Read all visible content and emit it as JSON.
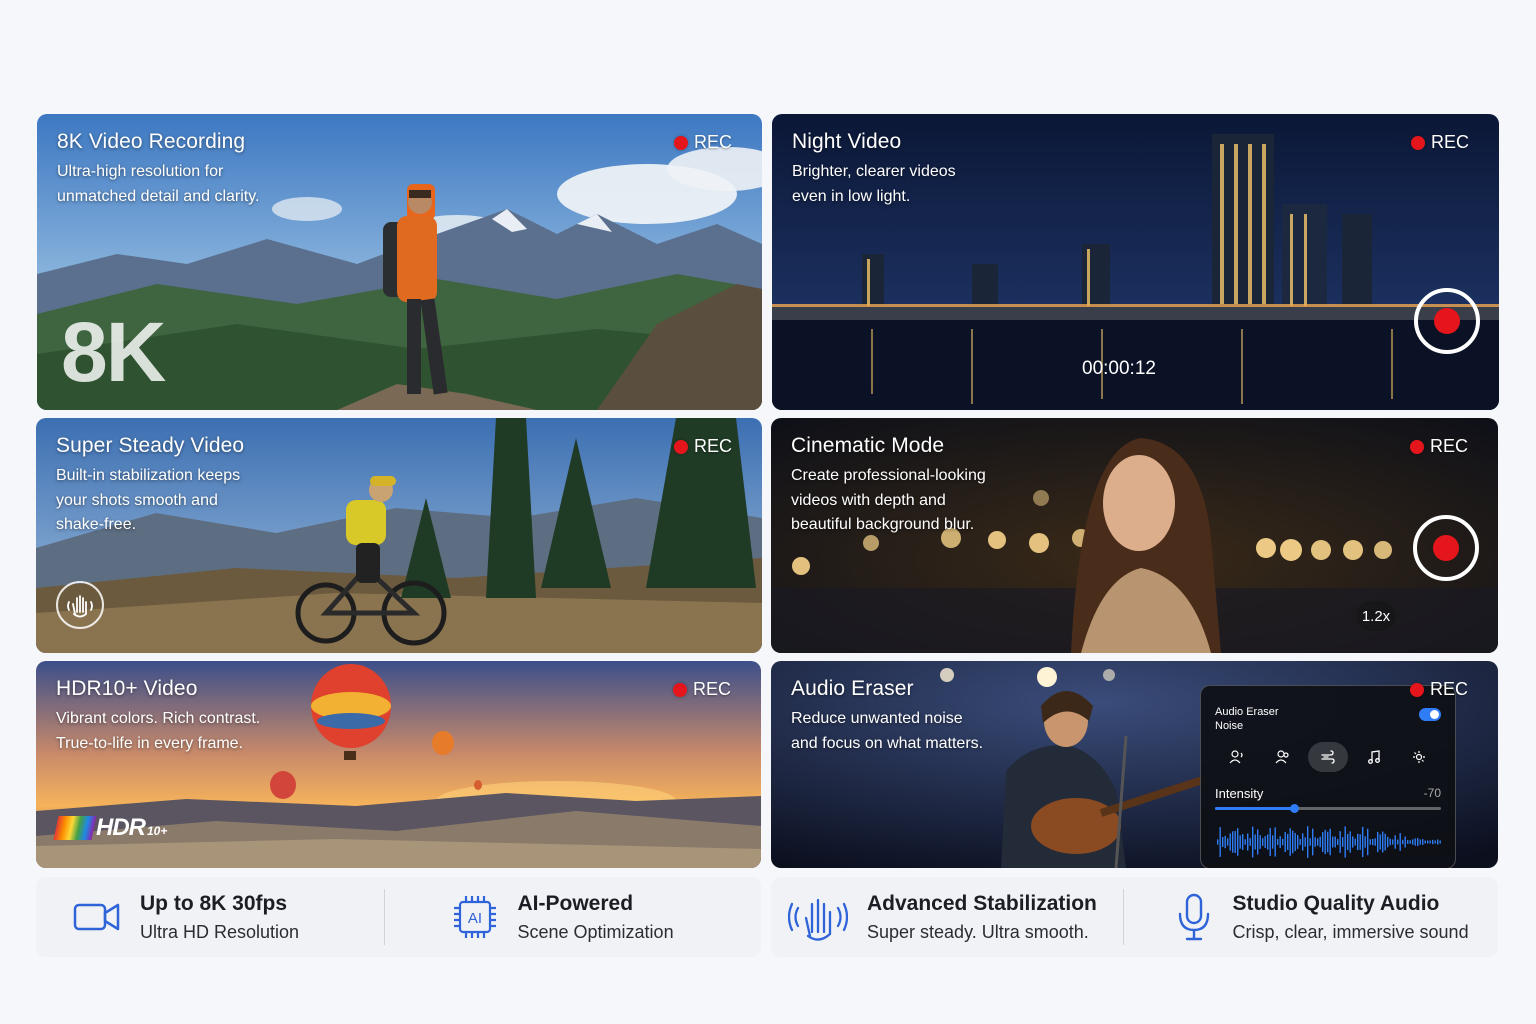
{
  "cards": [
    {
      "id": "8k",
      "title": "8K Video Recording",
      "description": "Ultra-high resolution for\nunmatched detail and clarity.",
      "rec": "REC",
      "badge": "8K"
    },
    {
      "id": "night",
      "title": "Night Video",
      "description": "Brighter, clearer videos\neven in low light.",
      "rec": "REC",
      "timer": "00:00:12"
    },
    {
      "id": "steady",
      "title": "Super Steady Video",
      "description": "Built-in stabilization keeps\nyour shots smooth and\nshake-free.",
      "rec": "REC"
    },
    {
      "id": "cinematic",
      "title": "Cinematic Mode",
      "description": "Create professional-looking\nvideos with depth and\nbeautiful background blur.",
      "rec": "REC",
      "zoom": "1.2x"
    },
    {
      "id": "hdr",
      "title": "HDR10+ Video",
      "description": "Vibrant colors. Rich contrast.\nTrue-to-life in every frame.",
      "rec": "REC",
      "logo_text": "HDR",
      "logo_sup": "10+"
    },
    {
      "id": "audio",
      "title": "Audio Eraser",
      "description": "Reduce unwanted noise\nand focus on what matters.",
      "rec": "REC"
    }
  ],
  "audio_panel": {
    "title": "Audio Eraser",
    "subtitle": "Noise",
    "intensity_label": "Intensity",
    "intensity_value": "-70",
    "intensity_fraction": 0.35,
    "toggle_on": true,
    "modes": [
      "voice-icon",
      "people-icon",
      "wind-icon",
      "music-icon",
      "nature-icon"
    ],
    "active_mode": 2
  },
  "features": [
    {
      "icon": "video-camera-icon",
      "heading": "Up to 8K 30fps",
      "sub": "Ultra HD Resolution"
    },
    {
      "icon": "ai-chip-icon",
      "heading": "AI-Powered",
      "sub": "Scene Optimization"
    },
    {
      "icon": "hand-stabilization-icon",
      "heading": "Advanced Stabilization",
      "sub": "Super steady. Ultra smooth."
    },
    {
      "icon": "microphone-icon",
      "heading": "Studio Quality Audio",
      "sub": "Crisp, clear, immersive sound"
    }
  ],
  "colors": {
    "rec_red": "#e5161b",
    "accent_blue": "#2f63d8",
    "panel_blue": "#2f7df6"
  }
}
